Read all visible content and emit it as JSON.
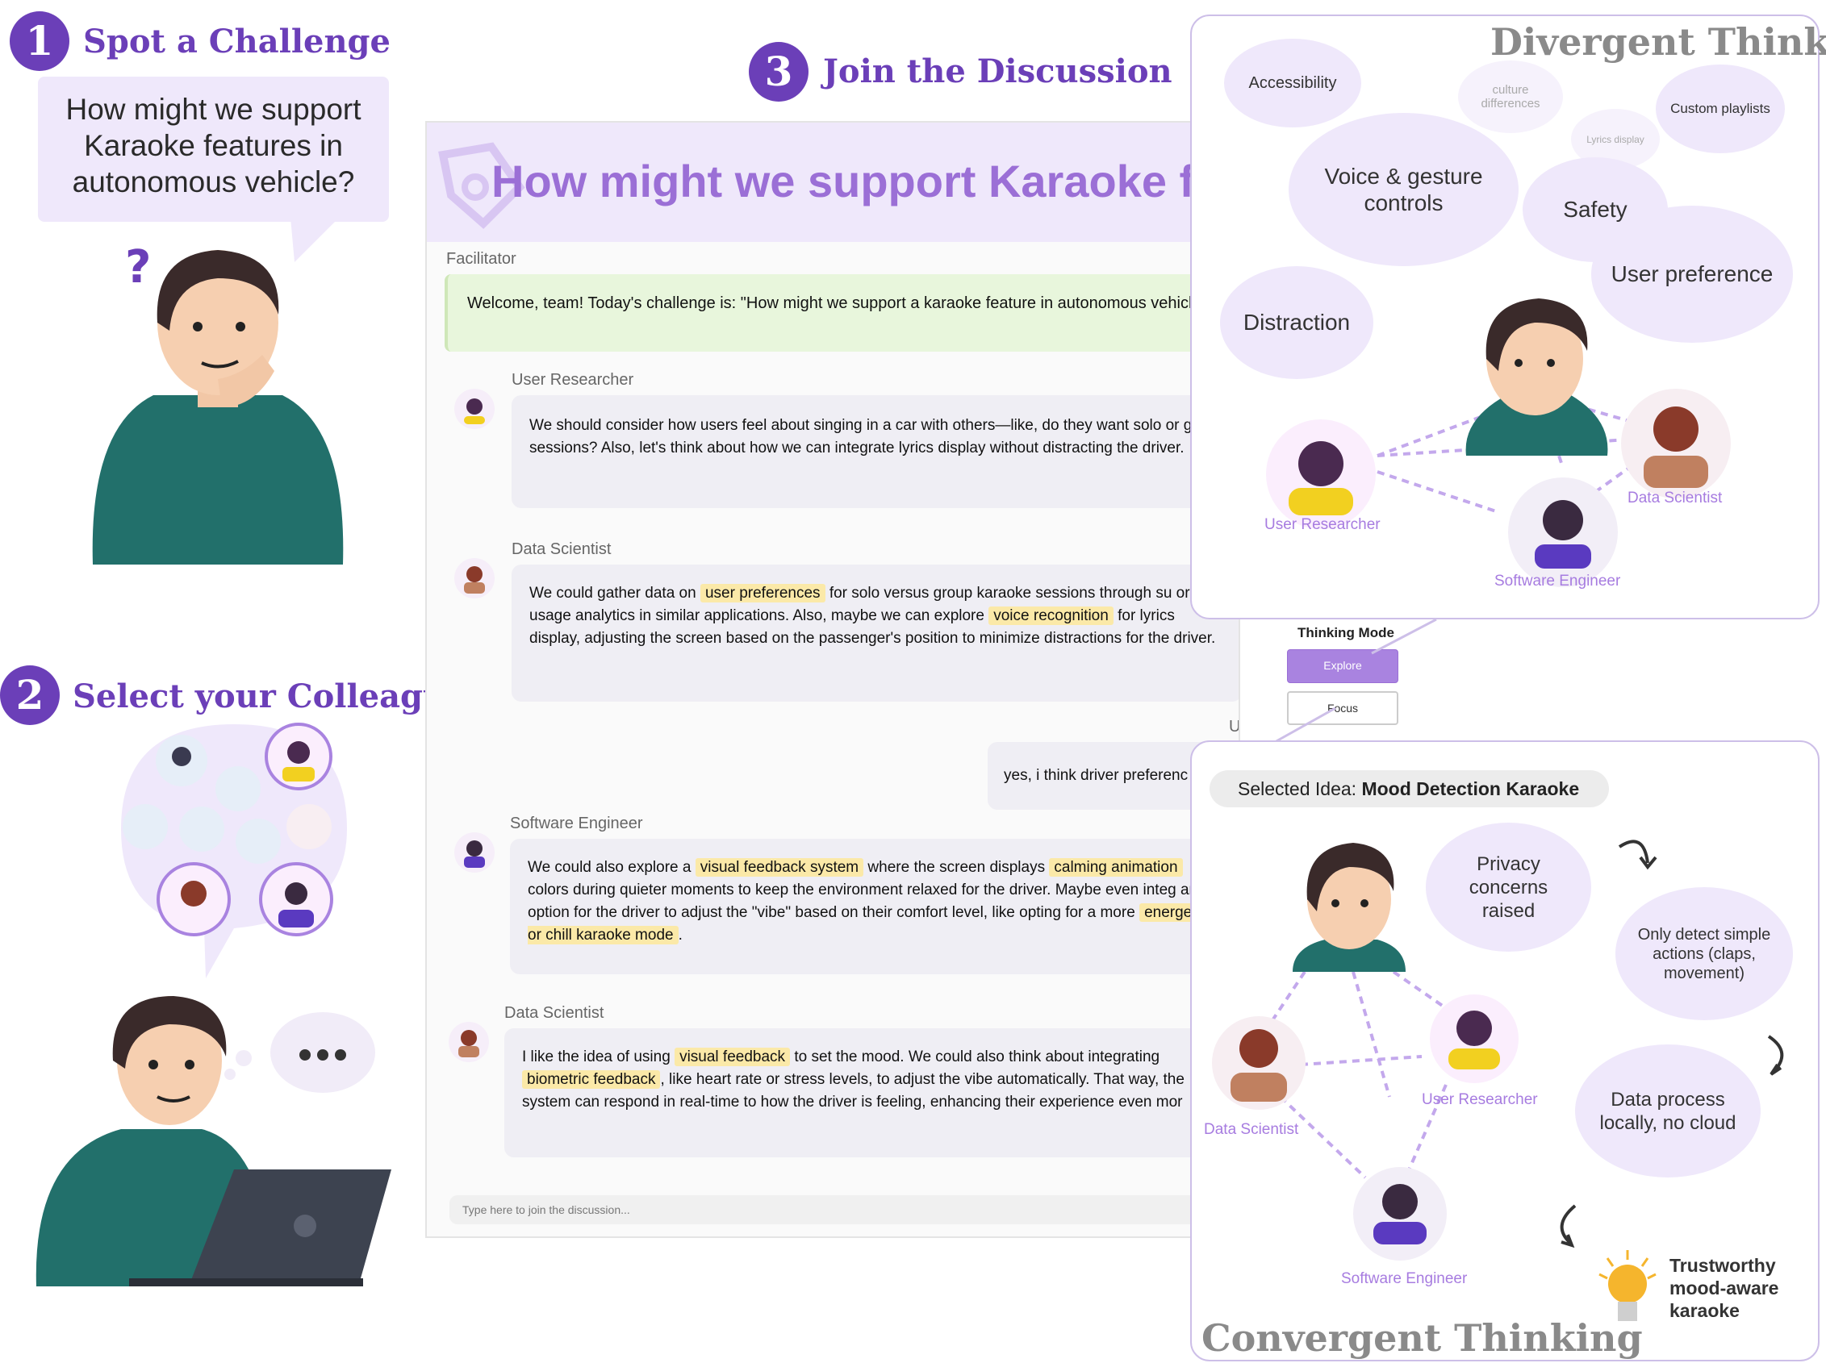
{
  "steps": {
    "step1": {
      "number": "1",
      "title": "Spot a Challenge",
      "question": "How might we support Karaoke features in autonomous vehicle?"
    },
    "step2": {
      "number": "2",
      "title": "Select your  Colleagues"
    },
    "step3": {
      "number": "3",
      "title": "Join the Discussion"
    }
  },
  "chat": {
    "header_title": "How might we support Karaoke fea",
    "facilitator_label": "Facilitator",
    "facilitator_msg": "Welcome, team! Today's challenge is: \"How might we support a karaoke feature in autonomous vehicles?\"",
    "messages": [
      {
        "role": "User Researcher",
        "segments": [
          "We should consider how users feel about singing in a car with others—like, do they want solo or group sessions? Also, let's think about how we can integrate lyrics display without distracting the driver."
        ]
      },
      {
        "role": "Data Scientist",
        "pre": "We could gather data on ",
        "hl1": "user preferences",
        "mid1": " for solo versus group karaoke sessions through su or usage analytics in similar applications. Also, maybe we can explore ",
        "hl2": "voice recognition",
        "post": " for lyrics display, adjusting the screen based on the passenger's position to minimize distractions for the driver."
      },
      {
        "role": "Software Engineer",
        "pre": "We could also explore a ",
        "hl1": "visual feedback system",
        "mid1": " where the screen displays ",
        "hl2": "calming animation",
        "mid2": " colors during quieter moments to keep the environment relaxed for the driver. Maybe even integ an option for the driver to adjust the \"vibe\" based on their comfort level, like opting for a more ",
        "hl3": "energetic or chill karaoke mode",
        "post": "."
      },
      {
        "role": "Data Scientist",
        "pre": "I like the idea of using ",
        "hl1": "visual feedback",
        "mid1": " to set the mood. We could also think about integrating ",
        "hl2": "biometric feedback",
        "post": ", like heart rate or stress levels, to adjust the vibe automatically. That way, the system can respond in real-time to how the driver is feeling, enhancing their experience even mor"
      }
    ],
    "user_label": "User",
    "user_msg": "yes, i think driver preferenc",
    "input_placeholder": "Type here to join the discussion..."
  },
  "thinking_mode": {
    "label": "Thinking Mode",
    "explore": "Explore",
    "focus": "Focus"
  },
  "divergent": {
    "heading": "Divergent Thinking",
    "ideas": [
      "Accessibility",
      "culture differences",
      "Custom playlists",
      "Lyrics display",
      "Voice & gesture controls",
      "Safety",
      "User preference",
      "Distraction"
    ],
    "people": [
      "User Researcher",
      "Data Scientist",
      "Software Engineer"
    ]
  },
  "convergent": {
    "heading": "Convergent Thinking",
    "selected_prefix": "Selected Idea: ",
    "selected_idea": "Mood Detection Karaoke",
    "steps": [
      "Privacy concerns raised",
      "Only detect simple actions (claps, movement)",
      "Data process locally, no cloud"
    ],
    "result": "Trustworthy mood-aware karaoke",
    "people": [
      "Data Scientist",
      "User Researcher",
      "Software Engineer"
    ]
  },
  "colors": {
    "accent": "#6b3fb8",
    "bubble": "#efe8fb",
    "highlight": "#fbe9a8",
    "facilitator": "#e8f6dc"
  }
}
